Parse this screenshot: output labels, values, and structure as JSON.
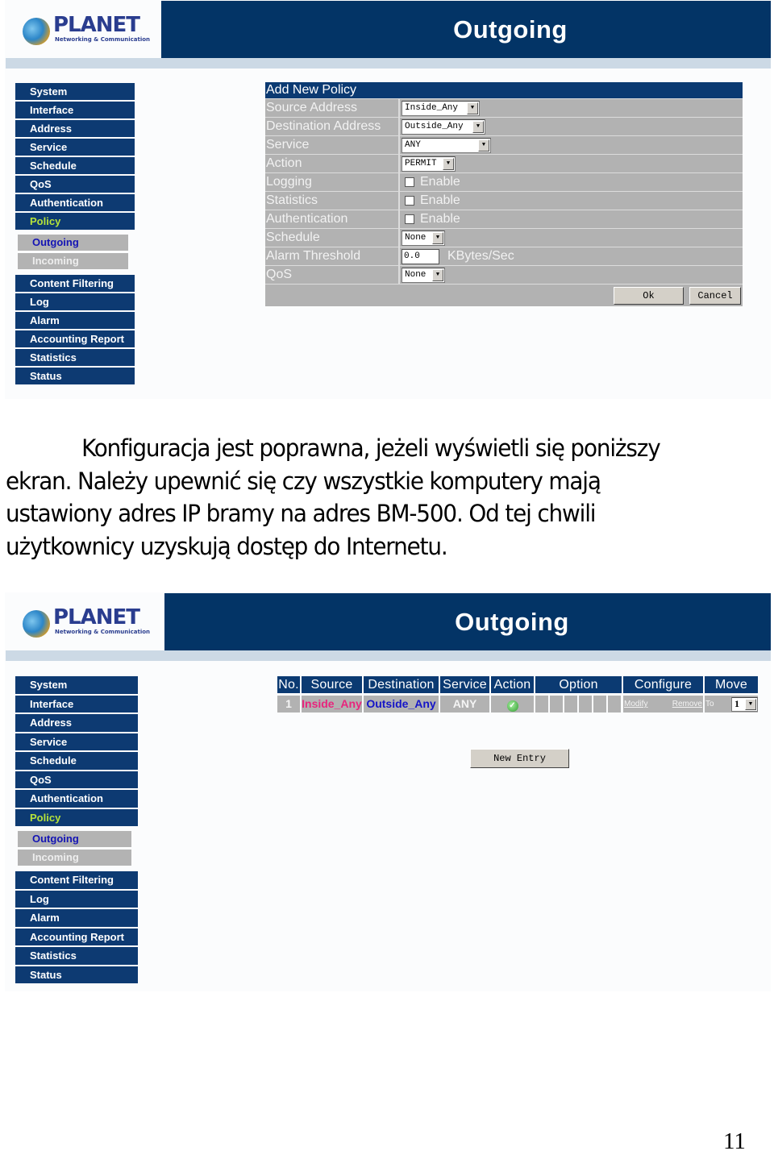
{
  "brand": {
    "logo_word": "PLANET",
    "logo_tagline": "Networking & Communication"
  },
  "colors": {
    "header_bg": "#033466",
    "nav_bg": "#0d3a72",
    "nav_active_text": "#b6e33a",
    "sub_nav_bg": "#b3b3b3",
    "sub_nav_active_text": "#1414b4",
    "form_bg": "#b2b2b2",
    "source_link": "#e8257d",
    "destination_link": "#1515c8"
  },
  "screenshot1": {
    "page_title": "Outgoing",
    "sidebar": {
      "items_top": [
        "System",
        "Interface",
        "Address",
        "Service",
        "Schedule",
        "QoS",
        "Authentication",
        "Policy"
      ],
      "active_item": "Policy",
      "sub_items": [
        "Outgoing",
        "Incoming"
      ],
      "active_sub_item": "Outgoing",
      "items_bottom": [
        "Content Filtering",
        "Log",
        "Alarm",
        "Accounting Report",
        "Statistics",
        "Status"
      ]
    },
    "form": {
      "heading": "Add New Policy",
      "source_address": {
        "label": "Source Address",
        "value": "Inside_Any"
      },
      "destination_address": {
        "label": "Destination Address",
        "value": "Outside_Any"
      },
      "service": {
        "label": "Service",
        "value": "ANY"
      },
      "action": {
        "label": "Action",
        "value": "PERMIT"
      },
      "logging": {
        "label": "Logging",
        "checkbox_label": "Enable",
        "checked": false
      },
      "statistics": {
        "label": "Statistics",
        "checkbox_label": "Enable",
        "checked": false
      },
      "authentication": {
        "label": "Authentication",
        "checkbox_label": "Enable",
        "checked": false
      },
      "schedule": {
        "label": "Schedule",
        "value": "None"
      },
      "alarm_threshold": {
        "label": "Alarm Threshold",
        "value": "0.0",
        "unit": "KBytes/Sec"
      },
      "qos": {
        "label": "QoS",
        "value": "None"
      },
      "ok_label": "Ok",
      "cancel_label": "Cancel"
    }
  },
  "caption": {
    "text": "Konfiguracja jest poprawna, jeżeli wyświetli się poniższy ekran. Należy upewnić się czy wszystkie komputery mają ustawiony adres IP bramy na adres BM-500. Od tej chwili użytkownicy uzyskują dostęp do Internetu.",
    "lines": [
      "Konfiguracja jest poprawna, jeżeli wyświetli się poniższy",
      "ekran. Należy upewnić się czy wszystkie komputery mają",
      "ustawiony adres IP bramy na adres BM-500. Od tej chwili",
      "użytkownicy uzyskują dostęp do Internetu."
    ]
  },
  "screenshot2": {
    "page_title": "Outgoing",
    "sidebar": {
      "items_top": [
        "System",
        "Interface",
        "Address",
        "Service",
        "Schedule",
        "QoS",
        "Authentication",
        "Policy"
      ],
      "active_item": "Policy",
      "sub_items": [
        "Outgoing",
        "Incoming"
      ],
      "active_sub_item": "Outgoing",
      "items_bottom": [
        "Content Filtering",
        "Log",
        "Alarm",
        "Accounting Report",
        "Statistics",
        "Status"
      ]
    },
    "table": {
      "headers": [
        "No.",
        "Source",
        "Destination",
        "Service",
        "Action",
        "Option",
        "Configure",
        "Move"
      ],
      "rows": [
        {
          "no": "1",
          "source": "Inside_Any",
          "destination": "Outside_Any",
          "service": "ANY",
          "action_icon": "check-icon",
          "option_icons": [
            "log-icon",
            "statistics-icon"
          ],
          "modify_label": "Modify",
          "remove_label": "Remove",
          "move_to_label": "To",
          "move_value": "1"
        }
      ]
    },
    "new_entry_label": "New Entry"
  },
  "page_number": "11"
}
